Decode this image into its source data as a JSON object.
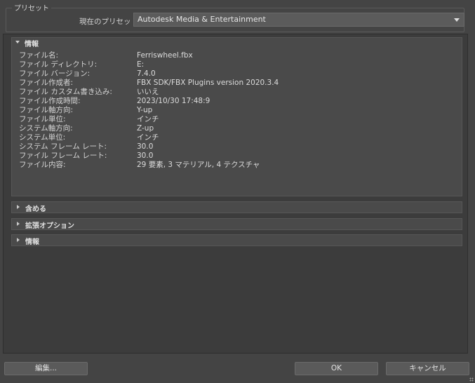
{
  "preset": {
    "group_title": "プリセット",
    "current_label": "現在のプリセット:",
    "current_value": "Autodesk Media & Entertainment"
  },
  "info_section": {
    "title": "情報",
    "rows": [
      {
        "label": "ファイル名:",
        "value": "Ferriswheel.fbx"
      },
      {
        "label": "ファイル ディレクトリ:",
        "value": "E:"
      },
      {
        "label": "ファイル バージョン:",
        "value": "7.4.0"
      },
      {
        "label": "ファイル作成者:",
        "value": "FBX SDK/FBX Plugins version 2020.3.4"
      },
      {
        "label": "ファイル カスタム書き込み:",
        "value": "いいえ"
      },
      {
        "label": "ファイル作成時間:",
        "value": "2023/10/30  17:48:9"
      },
      {
        "label": "ファイル軸方向:",
        "value": "Y-up"
      },
      {
        "label": "ファイル単位:",
        "value": "インチ"
      },
      {
        "label": "システム軸方向:",
        "value": "Z-up"
      },
      {
        "label": "システム単位:",
        "value": "インチ"
      },
      {
        "label": "システム フレーム レート:",
        "value": "30.0"
      },
      {
        "label": "ファイル フレーム レート:",
        "value": "30.0"
      },
      {
        "label": "ファイル内容:",
        "value": "29 要素,  3 マテリアル,  4 テクスチャ"
      }
    ]
  },
  "collapsed_sections": [
    "含める",
    "拡張オプション",
    "情報"
  ],
  "buttons": {
    "edit": "編集...",
    "ok": "OK",
    "cancel": "キャンセル"
  }
}
